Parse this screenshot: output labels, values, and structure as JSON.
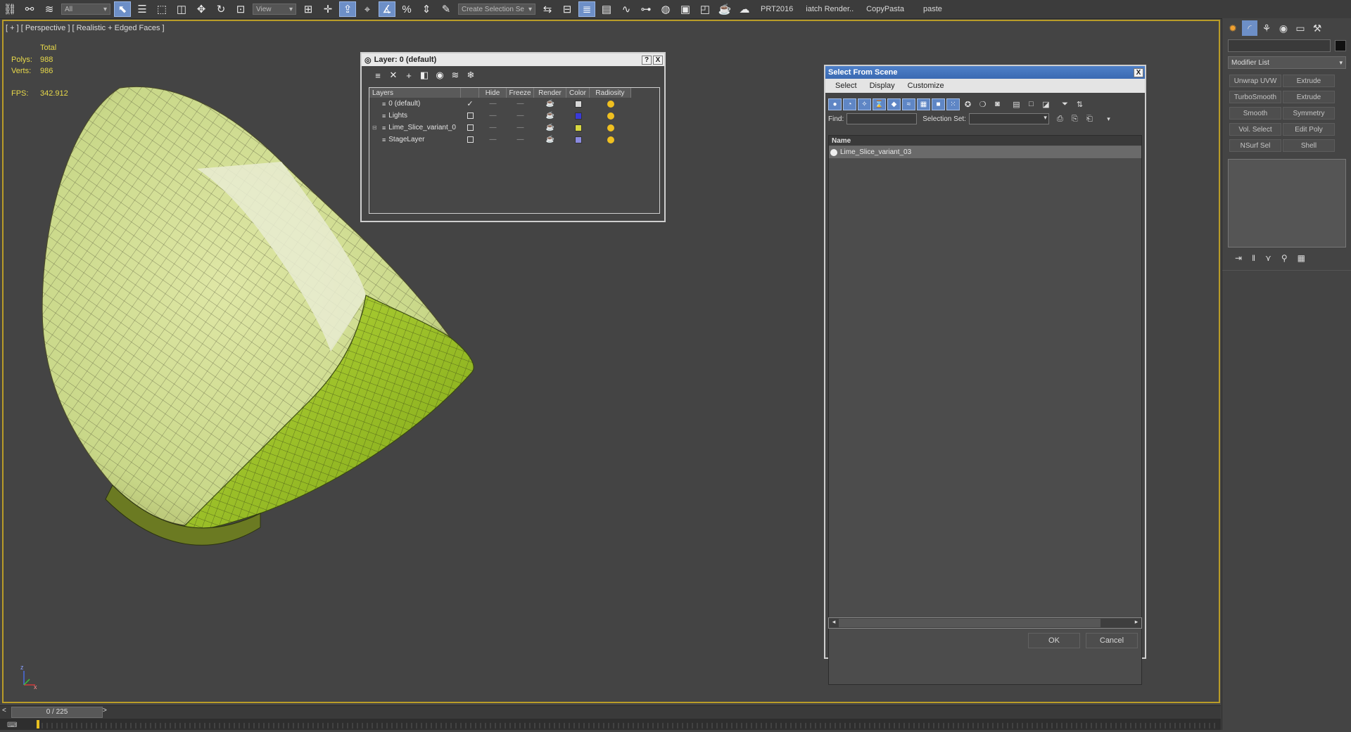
{
  "toolbar": {
    "selection_filter": "All",
    "ref_coord": "View",
    "named_selection_placeholder": "Create Selection Se",
    "text_items": [
      "PRT2016",
      "iatch Render..",
      "CopyPasta",
      "paste"
    ]
  },
  "viewport": {
    "label": "[ + ] [ Perspective ] [ Realistic + Edged Faces ]",
    "stats": {
      "total_label": "Total",
      "polys_label": "Polys:",
      "polys_value": "988",
      "verts_label": "Verts:",
      "verts_value": "986",
      "fps_label": "FPS:",
      "fps_value": "342.912"
    },
    "axis_z": "z",
    "axis_x": "x"
  },
  "timeline": {
    "frame": "0 / 225",
    "prev": "<",
    "next": ">"
  },
  "layer_dialog": {
    "title": "Layer: 0 (default)",
    "help": "?",
    "close": "X",
    "columns": [
      "Layers",
      "Hide",
      "Freeze",
      "Render",
      "Color",
      "Radiosity"
    ],
    "layers": [
      {
        "name": "0 (default)",
        "current": true,
        "color": "#d8d8d8"
      },
      {
        "name": "Lights",
        "current": false,
        "color": "#3a3ad8"
      },
      {
        "name": "Lime_Slice_variant_0",
        "current": false,
        "color": "#d8d840",
        "expandable": true
      },
      {
        "name": "StageLayer",
        "current": false,
        "color": "#8a8ae0"
      }
    ]
  },
  "select_dialog": {
    "title": "Select From Scene",
    "close": "X",
    "menu": [
      "Select",
      "Display",
      "Customize"
    ],
    "find_label": "Find:",
    "find_value": "",
    "selection_set_label": "Selection Set:",
    "selection_set_value": "",
    "column_header": "Name",
    "items": [
      "Lime_Slice_variant_03"
    ],
    "ok": "OK",
    "cancel": "Cancel"
  },
  "command_panel": {
    "modifier_list": "Modifier List",
    "modifiers": [
      [
        "Unwrap UVW",
        "Extrude"
      ],
      [
        "TurboSmooth",
        "Extrude"
      ],
      [
        "Smooth",
        "Symmetry"
      ],
      [
        "Vol. Select",
        "Edit Poly"
      ],
      [
        "NSurf Sel",
        "Shell"
      ]
    ]
  },
  "colors": {
    "viewport_border": "#b99c28",
    "stats_text": "#e8d94a",
    "accent_blue": "#5f86c5",
    "lime_flesh": "#d9e39a",
    "lime_peel": "#9cc421"
  }
}
